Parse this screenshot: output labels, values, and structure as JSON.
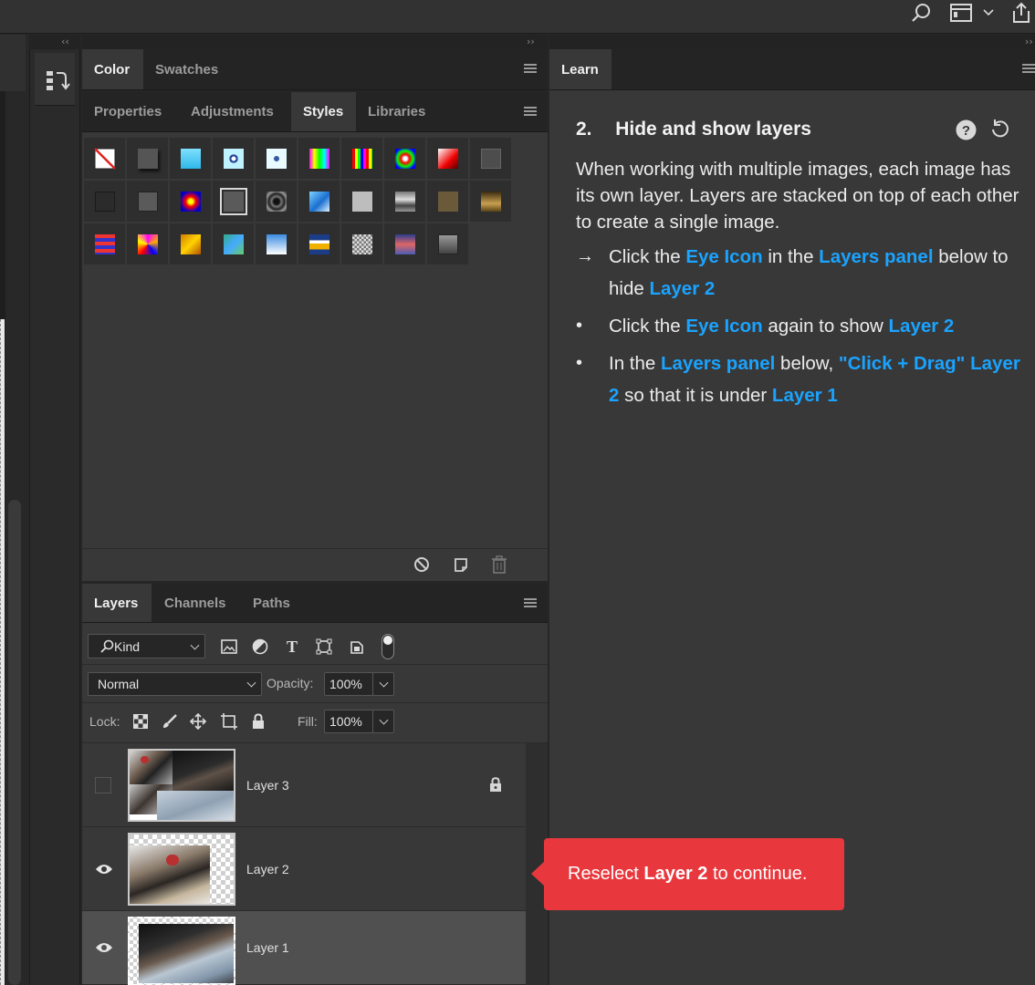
{
  "colors": {
    "accent": "#1aa3ff",
    "toast_bg": "#e8383d",
    "panel_bg": "#383838",
    "tab_bar_bg": "#242424"
  },
  "topbar": {
    "icons": [
      "search-icon",
      "workspace-icon",
      "chevron-down-icon",
      "share-icon"
    ]
  },
  "color_panel": {
    "tabs": [
      {
        "label": "Color",
        "active": true
      },
      {
        "label": "Swatches",
        "active": false
      }
    ]
  },
  "styles_panel": {
    "tabs": [
      {
        "label": "Properties",
        "active": false
      },
      {
        "label": "Adjustments",
        "active": false
      },
      {
        "label": "Styles",
        "active": true
      },
      {
        "label": "Libraries",
        "active": false
      }
    ],
    "footer_icons": [
      "clear-style-icon",
      "new-style-icon",
      "trash-icon"
    ]
  },
  "layers_panel": {
    "tabs": [
      {
        "label": "Layers",
        "active": true
      },
      {
        "label": "Channels",
        "active": false
      },
      {
        "label": "Paths",
        "active": false
      }
    ],
    "filter": {
      "kind_label": "Kind"
    },
    "blend_mode": "Normal",
    "opacity_label": "Opacity:",
    "opacity_value": "100%",
    "lock_label": "Lock:",
    "fill_label": "Fill:",
    "fill_value": "100%",
    "layers": [
      {
        "name": "Layer 3",
        "visible": false,
        "locked": true,
        "selected": false
      },
      {
        "name": "Layer 2",
        "visible": true,
        "locked": false,
        "selected": false
      },
      {
        "name": "Layer 1",
        "visible": true,
        "locked": false,
        "selected": true
      }
    ]
  },
  "learn_panel": {
    "tab_label": "Learn",
    "step_number": "2.",
    "step_title": "Hide and show layers",
    "intro": "When working with multiple images, each image has its own layer. Layers are stacked on top of each other to create a single image.",
    "bullets": {
      "b1": {
        "mark": "→",
        "t1": "Click the ",
        "h1": "Eye Icon",
        "t2": " in the ",
        "h2": "Layers panel",
        "t3": " below to hide ",
        "h3": "Layer 2",
        "t4": ""
      },
      "b2": {
        "mark": "•",
        "t1": "Click the ",
        "h1": "Eye Icon",
        "t2": " again to show ",
        "h2": "Layer 2",
        "t3": "",
        "h3": "",
        "t4": ""
      },
      "b3": {
        "mark": "•",
        "t1": "In the ",
        "h1": "Layers panel",
        "t2": " below, ",
        "h2": "\"Click + Drag\"",
        "t3": " ",
        "h3": "Layer 2",
        "t4": " so that it is under ",
        "h4": "Layer 1"
      }
    }
  },
  "toast": {
    "pre": "Reselect ",
    "bold": "Layer 2",
    "post": " to continue."
  }
}
